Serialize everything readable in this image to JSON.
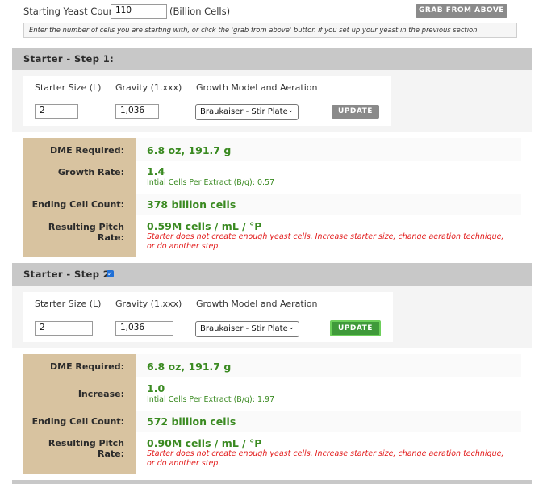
{
  "top": {
    "starting_label": "Starting Yeast Count:",
    "starting_value": "110",
    "unit": "(Billion Cells)",
    "grab_button": "GRAB FROM ABOVE",
    "hint": "Enter the number of cells you are starting with, or click the 'grab from above' button if you set up your yeast in the previous section."
  },
  "step1": {
    "header": "Starter - Step 1:",
    "size_label": "Starter Size (L)",
    "gravity_label": "Gravity (1.xxx)",
    "model_label": "Growth Model and Aeration",
    "size_value": "2",
    "gravity_value": "1,036",
    "model_value": "Braukaiser - Stir Plate",
    "update_button": "UPDATE",
    "results": {
      "dme_label": "DME Required:",
      "dme_value": "6.8 oz, 191.7 g",
      "growth_label": "Growth Rate:",
      "growth_value": "1.4",
      "growth_sub": "Intial Cells Per Extract (B/g): 0.57",
      "ending_label": "Ending Cell Count:",
      "ending_value": "378 billion cells",
      "pitch_label": "Resulting Pitch Rate:",
      "pitch_value": "0.59M cells / mL / °P",
      "warning": "Starter does not create enough yeast cells. Increase starter size, change aeration technique, or do another step."
    }
  },
  "step2": {
    "header": "Starter - Step 2:",
    "checkbox_checked": true,
    "size_label": "Starter Size (L)",
    "gravity_label": "Gravity (1.xxx)",
    "model_label": "Growth Model and Aeration",
    "size_value": "2",
    "gravity_value": "1,036",
    "model_value": "Braukaiser - Stir Plate",
    "update_button": "UPDATE",
    "results": {
      "dme_label": "DME Required:",
      "dme_value": "6.8 oz, 191.7 g",
      "increase_label": "Increase:",
      "increase_value": "1.0",
      "increase_sub": "Intial Cells Per Extract (B/g): 1.97",
      "ending_label": "Ending Cell Count:",
      "ending_value": "572 billion cells",
      "pitch_label": "Resulting Pitch Rate:",
      "pitch_value": "0.90M cells / mL / °P",
      "warning": "Starter does not create enough yeast cells. Increase starter size, change aeration technique, or do another step."
    }
  }
}
